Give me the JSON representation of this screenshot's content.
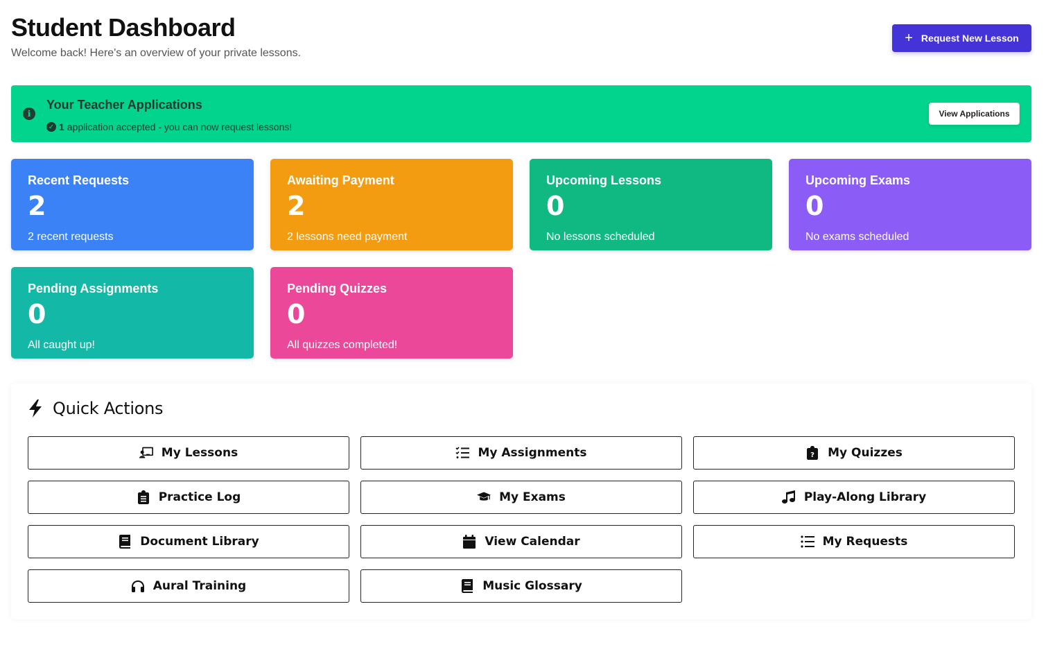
{
  "header": {
    "title": "Student Dashboard",
    "subtitle": "Welcome back! Here's an overview of your private lessons.",
    "primary_action": "Request New Lesson",
    "primary_icon": "plus-icon"
  },
  "banner": {
    "title": "Your Teacher Applications",
    "count": "1",
    "message": "application accepted - you can now request lessons!",
    "button": "View Applications",
    "color": "#02d38d"
  },
  "stats": [
    {
      "title": "Recent Requests",
      "value": "2",
      "subtitle": "2 recent requests",
      "color": "#3b82f6"
    },
    {
      "title": "Awaiting Payment",
      "value": "2",
      "subtitle": "2 lessons need payment",
      "color": "#f39c12"
    },
    {
      "title": "Upcoming Lessons",
      "value": "0",
      "subtitle": "No lessons scheduled",
      "color": "#10b981"
    },
    {
      "title": "Upcoming Exams",
      "value": "0",
      "subtitle": "No exams scheduled",
      "color": "#8b5cf6"
    },
    {
      "title": "Pending Assignments",
      "value": "0",
      "subtitle": "All caught up!",
      "color": "#14b8a6"
    },
    {
      "title": "Pending Quizzes",
      "value": "0",
      "subtitle": "All quizzes completed!",
      "color": "#ec4899"
    }
  ],
  "quick_actions": {
    "title": "Quick Actions",
    "icon": "bolt-icon",
    "items": [
      {
        "label": "My Lessons",
        "icon": "chalkboard-teacher-icon"
      },
      {
        "label": "My Assignments",
        "icon": "checklist-icon"
      },
      {
        "label": "My Quizzes",
        "icon": "clipboard-question-icon"
      },
      {
        "label": "Practice Log",
        "icon": "clipboard-list-icon"
      },
      {
        "label": "My Exams",
        "icon": "graduation-cap-icon"
      },
      {
        "label": "Play-Along Library",
        "icon": "music-note-icon"
      },
      {
        "label": "Document Library",
        "icon": "book-icon"
      },
      {
        "label": "View Calendar",
        "icon": "calendar-icon"
      },
      {
        "label": "My Requests",
        "icon": "list-icon"
      },
      {
        "label": "Aural Training",
        "icon": "headphones-icon"
      },
      {
        "label": "Music Glossary",
        "icon": "book-icon"
      }
    ]
  }
}
